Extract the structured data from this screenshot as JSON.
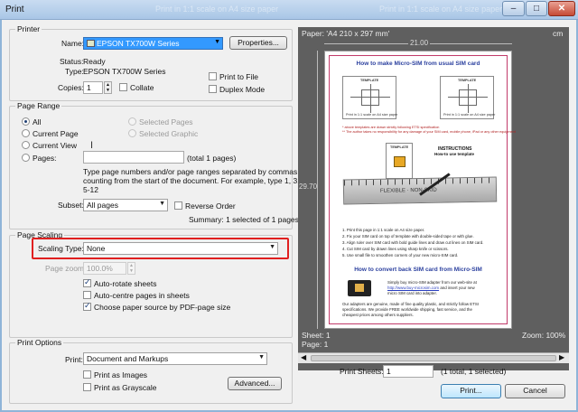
{
  "window": {
    "title": "Print",
    "ghost_title": "Print in 1:1 scale on A4 size paper",
    "ghost_title_2": "Print in 1:1 scale on A4 size paper",
    "minimize": "–",
    "maximize": "□",
    "close": "✕"
  },
  "printer": {
    "legend": "Printer",
    "name_label": "Name:",
    "name_value": "EPSON TX700W Series",
    "properties_button": "Properties...",
    "status_label": "Status:",
    "status_value": "Ready",
    "type_label": "Type:",
    "type_value": "EPSON TX700W Series",
    "print_to_file": "Print to File",
    "copies_label": "Copies:",
    "copies_value": "1",
    "collate": "Collate",
    "duplex_mode": "Duplex Mode"
  },
  "page_range": {
    "legend": "Page Range",
    "all": "All",
    "current_page": "Current Page",
    "current_view": "Current View",
    "pages": "Pages:",
    "selected_pages": "Selected Pages",
    "selected_graphic": "Selected Graphic",
    "pages_total": "(total 1 pages)",
    "help_line1": "Type page numbers and/or page ranges separated by commas",
    "help_line2": "counting from the start of the document. For example, type 1, 3,",
    "help_line3": "5-12",
    "subset_label": "Subset:",
    "subset_value": "All pages",
    "reverse_order": "Reverse Order",
    "summary": "Summary: 1 selected of 1 pages"
  },
  "page_scaling": {
    "legend": "Page Scaling",
    "scaling_type_label": "Scaling Type:",
    "scaling_type_value": "None",
    "page_zoom_label": "Page zoom:",
    "page_zoom_value": "100.0%",
    "auto_rotate": "Auto-rotate sheets",
    "auto_centre": "Auto-centre pages in sheets",
    "choose_source": "Choose paper source by PDF-page size"
  },
  "print_options": {
    "legend": "Print Options",
    "print_label": "Print:",
    "print_value": "Document and Markups",
    "print_as_images": "Print as Images",
    "print_as_grayscale": "Print as Grayscale",
    "advanced_button": "Advanced..."
  },
  "preview": {
    "paper_label": "Paper: 'A4 210 x 297 mm'",
    "unit": "cm",
    "width_dim": "21.00",
    "height_dim": "29.70",
    "sheet_label": "Sheet: 1",
    "page_label": "Page: 1",
    "zoom_label": "Zoom: 100%",
    "doc": {
      "title": "How to make Micro-SIM from usual SIM card",
      "template_label": "TEMPLATE",
      "caption": "Print in 1:1 scale on A4 size paper",
      "note1": "* above templates are drawn strictly following ETSI specification",
      "note2": "** The author takes no responsibility for any damage of your SIM card, mobile phone, iPad or any other equipment",
      "instructions_title": "INSTRUCTIONS",
      "instructions_sub": "How-to use template",
      "ruler_text": "FLEXIBLE · NON-SKID",
      "steps": [
        "1. Print this page in 1:1 scale on A4 size paper.",
        "2. Fix your SIM card on top of template with double-sided tape or with glue.",
        "3. Align ruler over SIM card with bold guide lines and draw cut lines on SIM card.",
        "4. Cut SIM card by drawn lines using sharp knife or scissors.",
        "5. Use small file to smoothen corners of your new micro-SIM card."
      ],
      "convert_title": "How to convert back SIM card from Micro-SIM",
      "buy_text1": "Simply buy micro-SIM adapter from our web-site at",
      "buy_link": "http://www.buy-microsim.com",
      "buy_text2": "and insert your new",
      "buy_text3": "micro SIM card into adapter.",
      "adapter_text1": "Our adapters are genuine, made of fine quality plastic, and strictly follow ETSI",
      "adapter_text2": "specifications. We provide FREE worldwide shipping, fast service, and the",
      "adapter_text3": "cheapest prices among others suppliers."
    }
  },
  "bottom": {
    "print_sheets_label": "Print Sheets:",
    "print_sheets_value": "1",
    "print_sheets_summary": "(1 total, 1 selected)",
    "print_button": "Print...",
    "cancel_button": "Cancel"
  }
}
